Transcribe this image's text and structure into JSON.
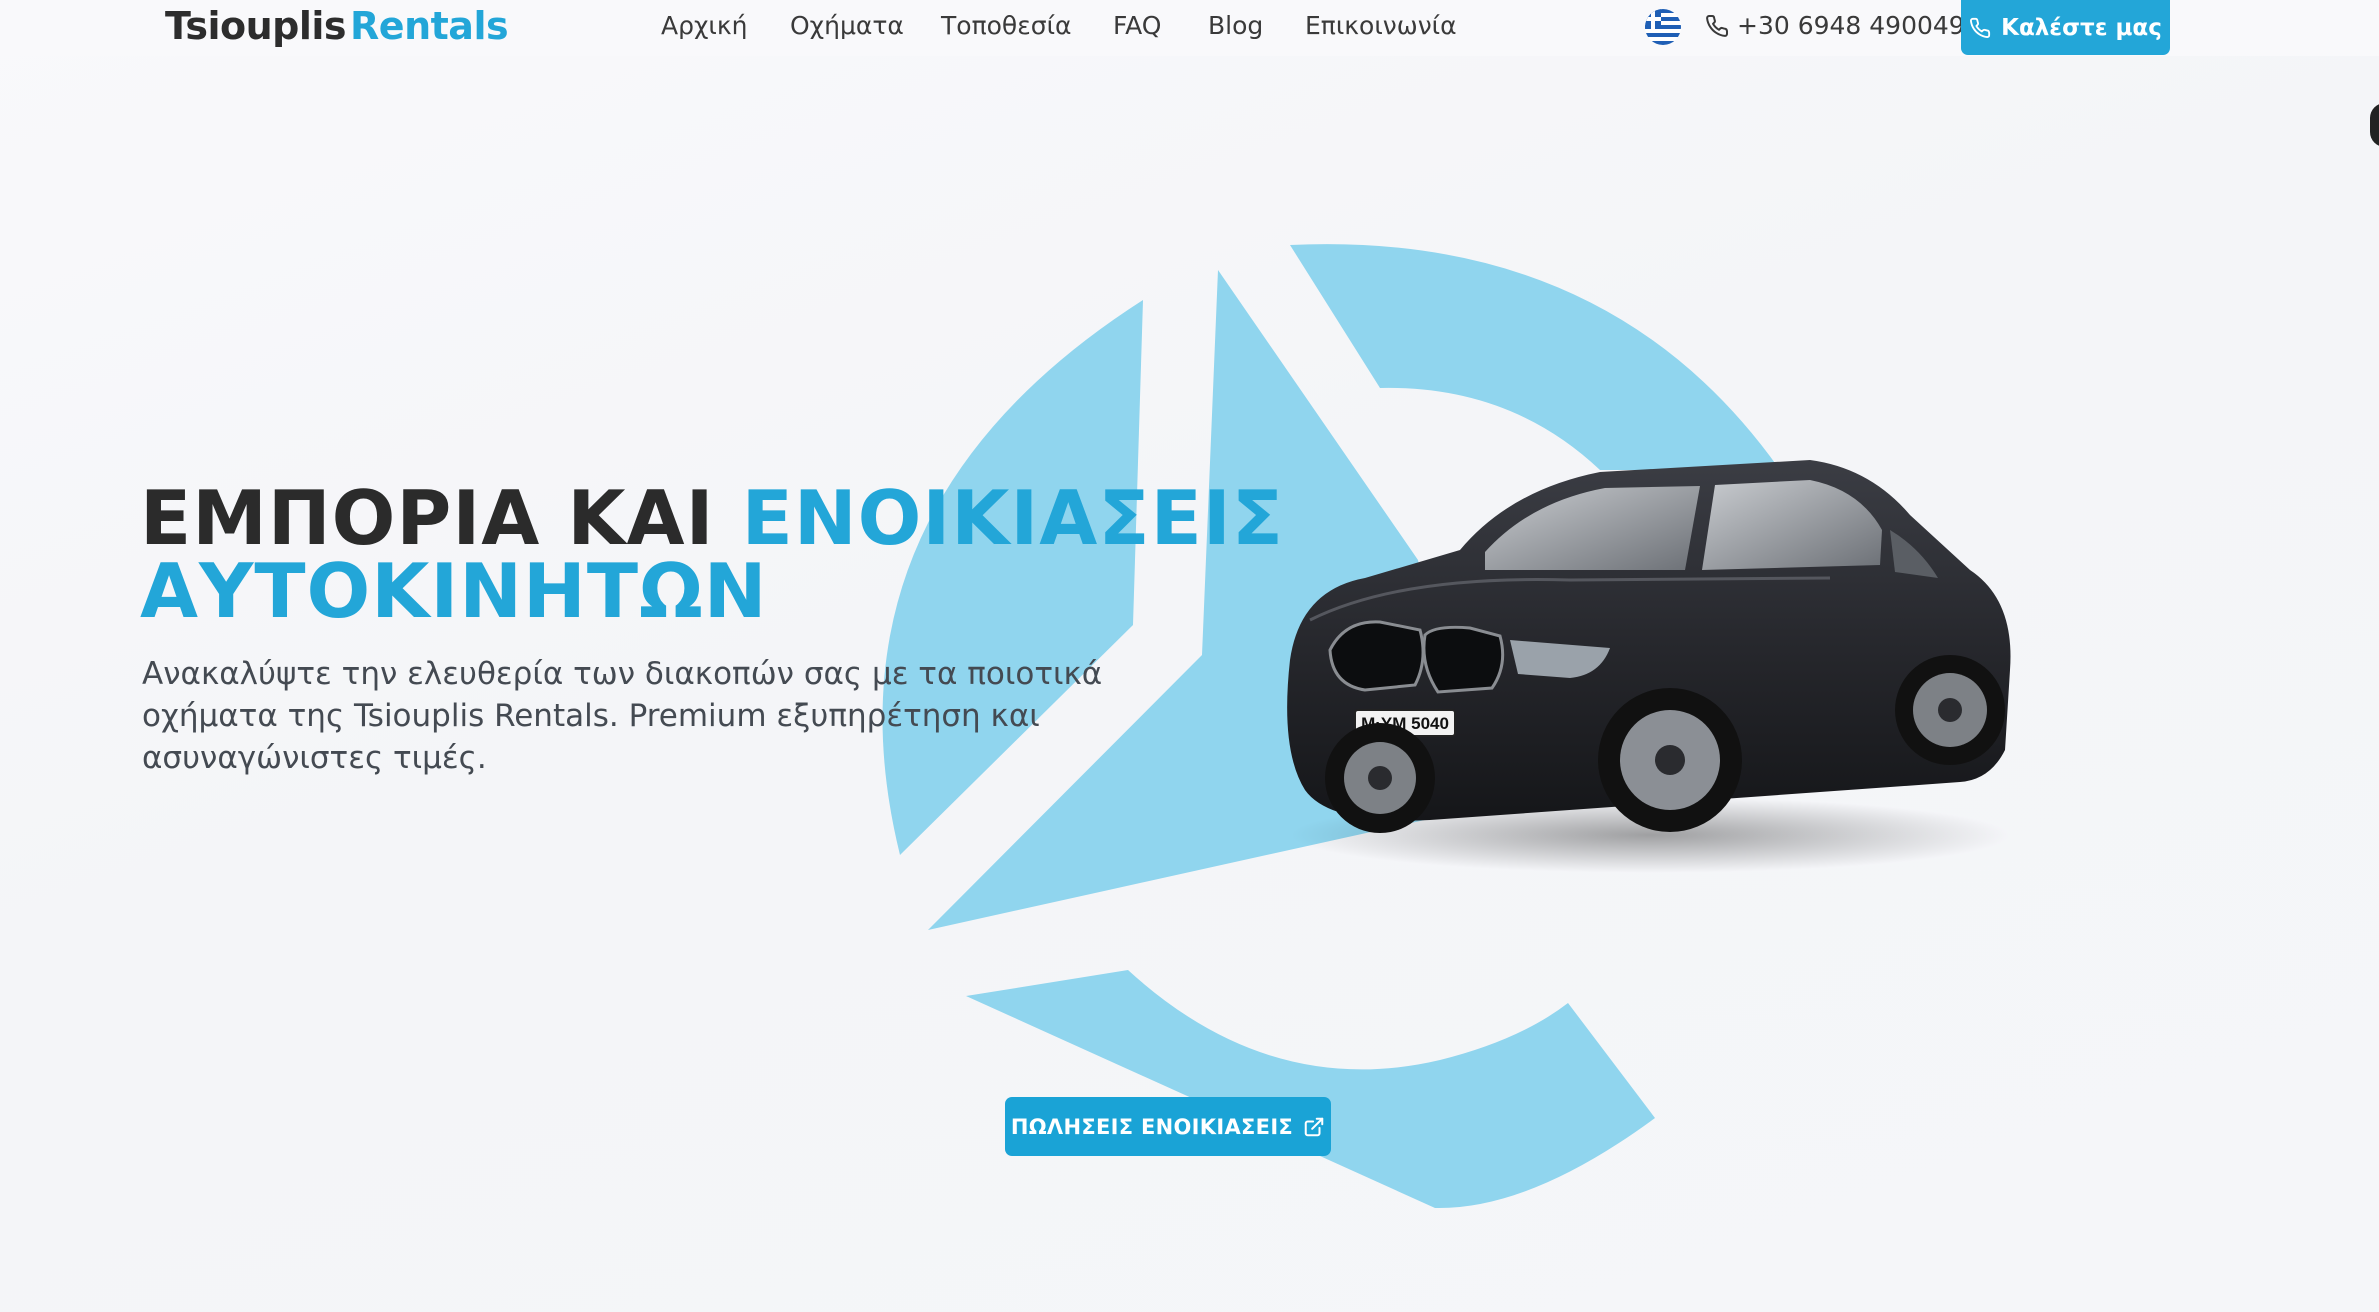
{
  "header": {
    "logo_part1": "Tsiouplis",
    "logo_part2": "Rentals",
    "nav": [
      {
        "label": "Αρχική"
      },
      {
        "label": "Οχήματα"
      },
      {
        "label": "Τοποθεσία"
      },
      {
        "label": "FAQ"
      },
      {
        "label": "Blog"
      },
      {
        "label": "Επικοινωνία"
      }
    ],
    "language_flag": "greek-flag-icon",
    "phone": "+30 6948 490049",
    "call_button": "Καλέστε μας"
  },
  "hero": {
    "headline_dark": "ΕΜΠΟΡΙΑ ΚΑΙ",
    "headline_blue_1": "ΕΝΟΙΚΙΑΣΕΙΣ",
    "headline_blue_2": "ΑΥΤΟΚΙΝΗΤΩΝ",
    "subtitle": "Ανακαλύψτε την ελευθερία των διακοπών σας με τα ποιοτικά οχήματα της Tsiouplis Rentals. Premium εξυπηρέτηση και ασυναγώνιστες τιμές.",
    "car_plate": "M·YM 5040",
    "cta_label": "ΠΩΛΗΣΕΙΣ ΕΝΟΙΚΙΑΣΕΙΣ"
  },
  "colors": {
    "accent": "#23a6d8",
    "logo_shape": "#90d5ee",
    "text_dark": "#2b2b2b"
  }
}
